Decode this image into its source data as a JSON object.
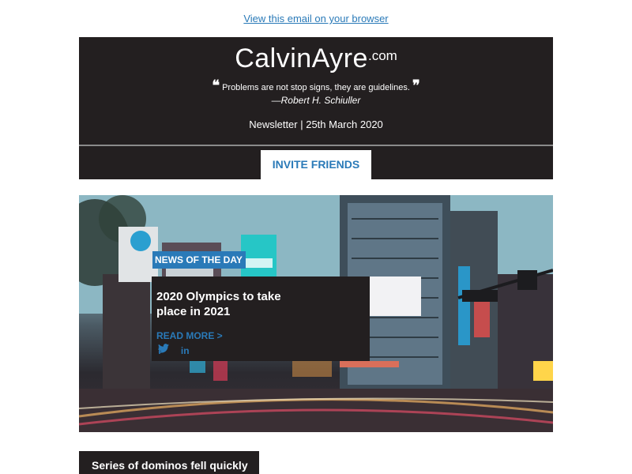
{
  "browser_link": "View this email on your browser",
  "header": {
    "logo_main": "CalvinAyre",
    "logo_com": ".com",
    "quote_open": "❝",
    "quote_text": "Problems are not stop signs, they are guidelines.",
    "quote_close": "❞",
    "quote_author": "—Robert H. Schiuller",
    "newsletter_date": "Newsletter | 25th March 2020",
    "invite_label": "INVITE FRIENDS"
  },
  "hero": {
    "tag": "NEWS OF THE DAY",
    "title": "2020 Olympics to take place in 2021",
    "read_more": "READ MORE >",
    "social_icons": [
      "facebook-icon",
      "twitter-icon",
      "linkedin-icon"
    ]
  },
  "next_article": {
    "headline": "Series of dominos fell quickly"
  },
  "colors": {
    "dark": "#231f20",
    "accent_blue": "#2a7ab8",
    "white": "#ffffff"
  }
}
